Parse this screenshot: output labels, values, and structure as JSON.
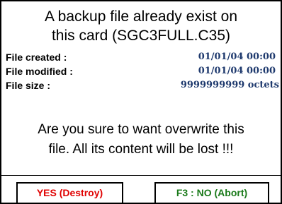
{
  "dialog": {
    "title_line1": "A backup file already exist on",
    "title_line2": "this card (SGC3FULL.C35)",
    "info": {
      "created_label": "File created :",
      "created_value": "01/01/04 00:00",
      "modified_label": "File modified :",
      "modified_value": "01/01/04 00:00",
      "size_label": "File size :",
      "size_value": "9999999999 octets"
    },
    "warning_line1": "Are you sure to want overwrite this",
    "warning_line2": "file. All its content will be lost !!!",
    "buttons": {
      "yes_label": "YES (Destroy)",
      "no_label": "F3 : NO (Abort)"
    }
  },
  "colors": {
    "value_text": "#1f3a6e",
    "yes_text": "#e00000",
    "no_text": "#1a7a1a",
    "border": "#000000",
    "background": "#ffffff"
  }
}
